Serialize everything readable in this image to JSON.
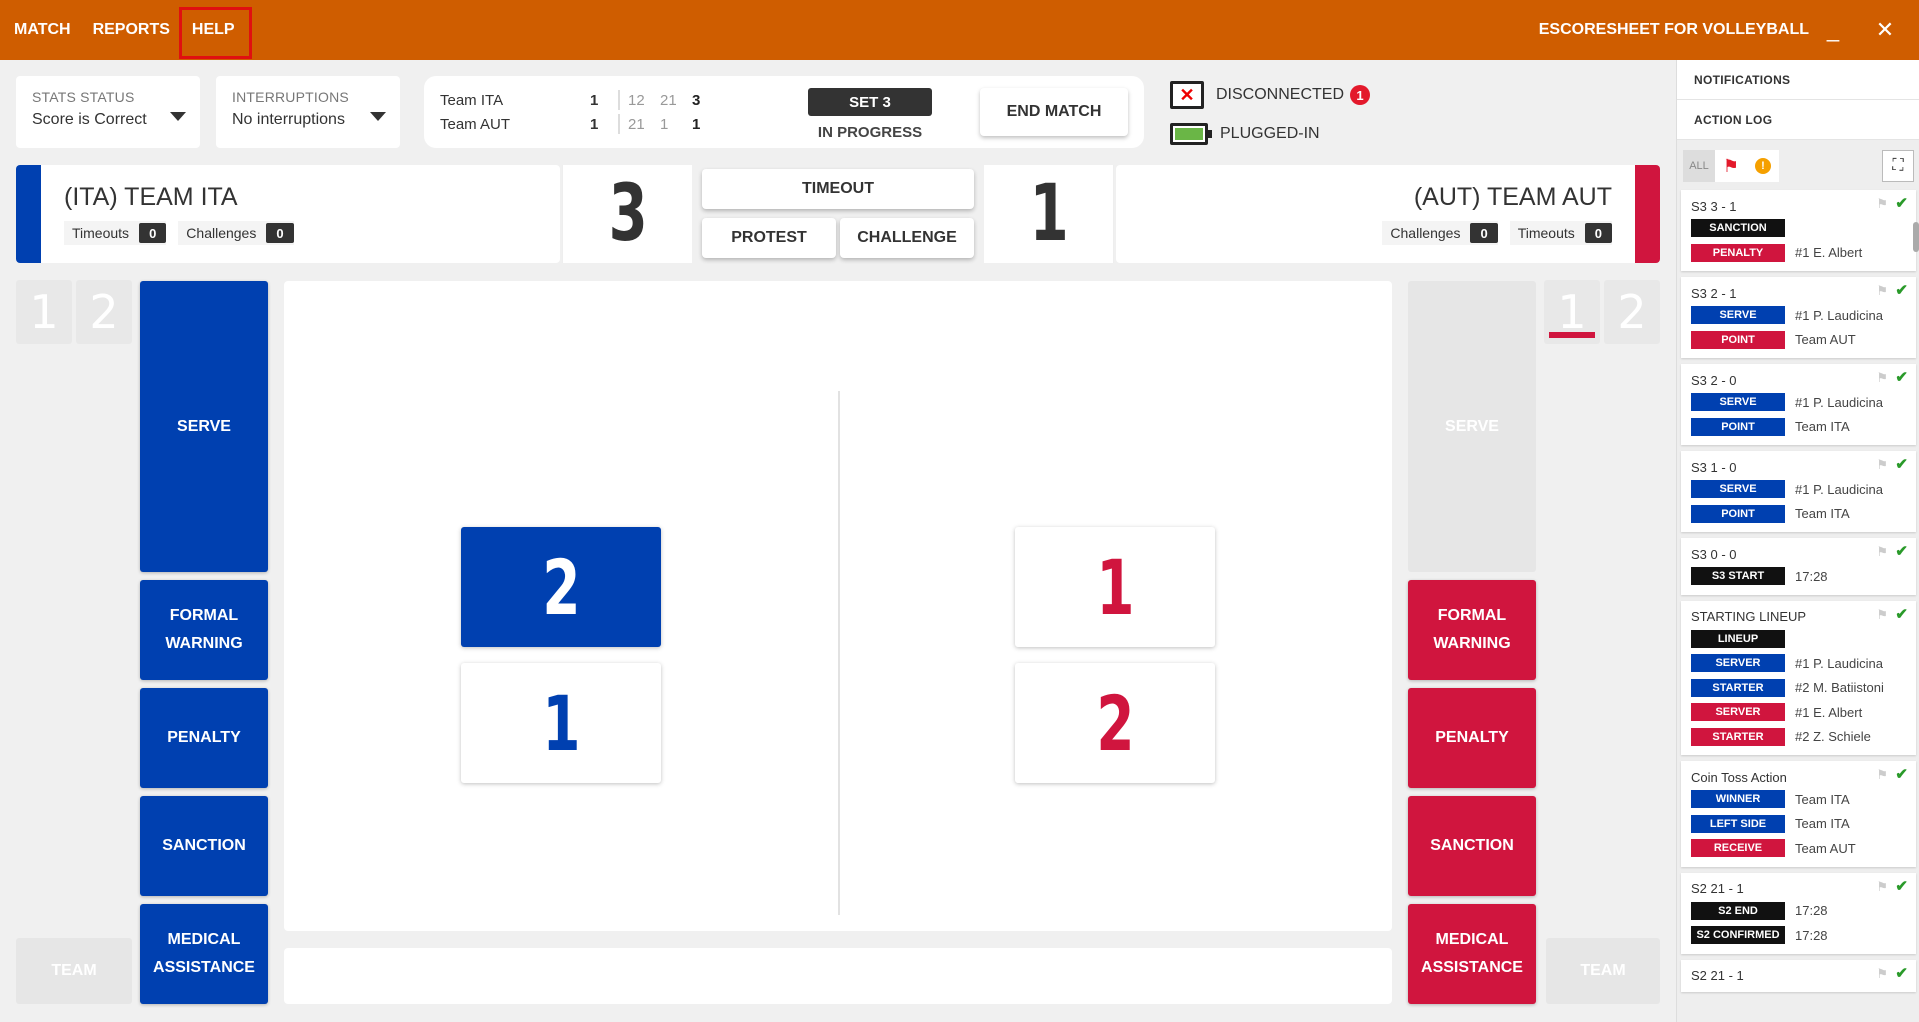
{
  "nav": {
    "match": "MATCH",
    "reports": "REPORTS",
    "help": "HELP"
  },
  "app_title": "ESCORESHEET FOR VOLLEYBALL",
  "window": {
    "minimize": "_",
    "close": "✕"
  },
  "stats_status": {
    "label": "STATS STATUS",
    "value": "Score is Correct"
  },
  "interruptions": {
    "label": "INTERRUPTIONS",
    "value": "No interruptions"
  },
  "scoreboard": {
    "teams": [
      {
        "name": "Team ITA",
        "sets_won": "1",
        "set_scores": [
          "12",
          "21",
          "3"
        ]
      },
      {
        "name": "Team AUT",
        "sets_won": "1",
        "set_scores": [
          "21",
          "1",
          "1"
        ]
      }
    ],
    "set_label": "SET 3",
    "set_status": "IN PROGRESS",
    "end_match": "END MATCH"
  },
  "connection": {
    "disconnected": "DISCONNECTED",
    "notifications_count": "1",
    "plugged": "PLUGGED-IN"
  },
  "colors": {
    "ita": "#0040b0",
    "aut": "#d0153e",
    "topbar": "#cf5d00"
  },
  "team_left": {
    "name": "(ITA) TEAM ITA",
    "timeouts_label": "Timeouts",
    "timeouts": "0",
    "challenges_label": "Challenges",
    "challenges": "0",
    "score": "3"
  },
  "team_right": {
    "name": "(AUT) TEAM AUT",
    "timeouts_label": "Timeouts",
    "timeouts": "0",
    "challenges_label": "Challenges",
    "challenges": "0",
    "score": "1"
  },
  "center_buttons": {
    "timeout": "TIMEOUT",
    "protest": "PROTEST",
    "challenge": "CHALLENGE"
  },
  "left_sets": [
    "1",
    "2"
  ],
  "right_sets": [
    "1",
    "2"
  ],
  "left_actions": {
    "serve": "SERVE",
    "formal_warning_1": "FORMAL",
    "formal_warning_2": "WARNING",
    "penalty": "PENALTY",
    "sanction": "SANCTION",
    "medical_1": "MEDICAL",
    "medical_2": "ASSISTANCE",
    "team": "TEAM"
  },
  "right_actions": {
    "serve": "SERVE",
    "formal_warning_1": "FORMAL",
    "formal_warning_2": "WARNING",
    "penalty": "PENALTY",
    "sanction": "SANCTION",
    "medical_1": "MEDICAL",
    "medical_2": "ASSISTANCE",
    "team": "TEAM"
  },
  "court": {
    "ita_players": [
      "2",
      "1"
    ],
    "aut_players": [
      "1",
      "2"
    ]
  },
  "panel": {
    "notifications": "NOTIFICATIONS",
    "action_log": "ACTION LOG",
    "filter_all": "ALL",
    "filter_flag_icon": "flag-icon",
    "filter_warning": "!",
    "expand_icon": "expand-icon"
  },
  "log": [
    {
      "head": "S3  3 - 1",
      "rows": [
        {
          "tag": "SANCTION",
          "color": "black",
          "text": ""
        },
        {
          "tag": "PENALTY",
          "color": "red",
          "text": "#1 E. Albert"
        }
      ]
    },
    {
      "head": "S3  2 - 1",
      "rows": [
        {
          "tag": "SERVE",
          "color": "blue",
          "text": "#1 P. Laudicina"
        },
        {
          "tag": "POINT",
          "color": "red",
          "text": "Team AUT"
        }
      ]
    },
    {
      "head": "S3  2 - 0",
      "rows": [
        {
          "tag": "SERVE",
          "color": "blue",
          "text": "#1 P. Laudicina"
        },
        {
          "tag": "POINT",
          "color": "blue",
          "text": "Team ITA"
        }
      ]
    },
    {
      "head": "S3  1 - 0",
      "rows": [
        {
          "tag": "SERVE",
          "color": "blue",
          "text": "#1 P. Laudicina"
        },
        {
          "tag": "POINT",
          "color": "blue",
          "text": "Team ITA"
        }
      ]
    },
    {
      "head": "S3  0 - 0",
      "rows": [
        {
          "tag": "S3 START",
          "color": "black",
          "text": "17:28"
        }
      ]
    },
    {
      "head": "STARTING LINEUP",
      "rows": [
        {
          "tag": "LINEUP",
          "color": "black",
          "text": ""
        },
        {
          "tag": "SERVER",
          "color": "blue",
          "text": "#1 P. Laudicina"
        },
        {
          "tag": "STARTER",
          "color": "blue",
          "text": "#2 M. Batiistoni"
        },
        {
          "tag": "SERVER",
          "color": "red",
          "text": "#1 E. Albert"
        },
        {
          "tag": "STARTER",
          "color": "red",
          "text": "#2 Z. Schiele"
        }
      ]
    },
    {
      "head": "Coin Toss Action",
      "rows": [
        {
          "tag": "WINNER",
          "color": "blue",
          "text": "Team ITA"
        },
        {
          "tag": "LEFT SIDE",
          "color": "blue",
          "text": "Team ITA"
        },
        {
          "tag": "RECEIVE",
          "color": "red",
          "text": "Team AUT"
        }
      ]
    },
    {
      "head": "S2  21 - 1",
      "rows": [
        {
          "tag": "S2 END",
          "color": "black",
          "text": "17:28"
        },
        {
          "tag": "S2 CONFIRMED",
          "color": "black",
          "text": "17:28"
        }
      ]
    },
    {
      "head": "S2  21 - 1",
      "rows": []
    }
  ]
}
